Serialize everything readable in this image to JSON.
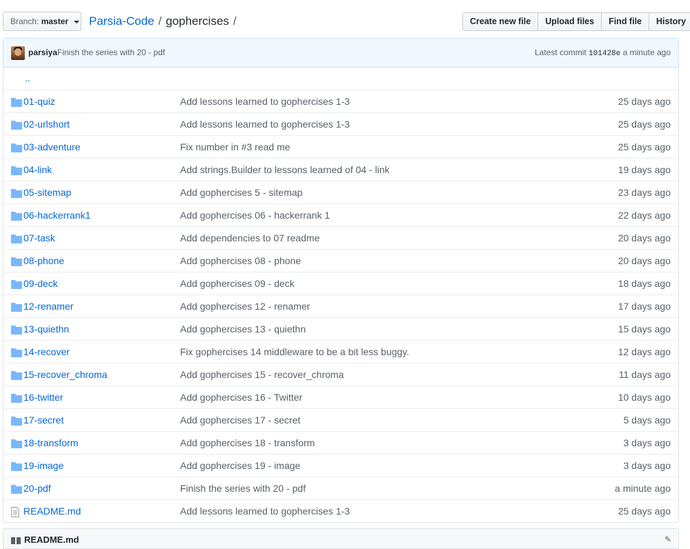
{
  "branch": {
    "label": "Branch:",
    "value": "master"
  },
  "breadcrumb": {
    "owner": "Parsia-Code",
    "separator": "/",
    "repo": "gophercises"
  },
  "actions": {
    "create_new_file": "Create new file",
    "upload_files": "Upload files",
    "find_file": "Find file",
    "history": "History"
  },
  "latest_commit": {
    "author": "parsiya",
    "message": "Finish the series with 20 - pdf",
    "label": "Latest commit",
    "sha": "101428e",
    "time": "a minute ago"
  },
  "parent_dir": "..",
  "files": [
    {
      "name": "01-quiz",
      "type": "dir",
      "message": "Add lessons learned to gophercises 1-3",
      "age": "25 days ago"
    },
    {
      "name": "02-urlshort",
      "type": "dir",
      "message": "Add lessons learned to gophercises 1-3",
      "age": "25 days ago"
    },
    {
      "name": "03-adventure",
      "type": "dir",
      "message": "Fix number in #3 read me",
      "age": "25 days ago"
    },
    {
      "name": "04-link",
      "type": "dir",
      "message": "Add strings.Builder to lessons learned of 04 - link",
      "age": "19 days ago"
    },
    {
      "name": "05-sitemap",
      "type": "dir",
      "message": "Add gophercises 5 - sitemap",
      "age": "23 days ago"
    },
    {
      "name": "06-hackerrank1",
      "type": "dir",
      "message": "Add gophercises 06 - hackerrank 1",
      "age": "22 days ago"
    },
    {
      "name": "07-task",
      "type": "dir",
      "message": "Add dependencies to 07 readme",
      "age": "20 days ago"
    },
    {
      "name": "08-phone",
      "type": "dir",
      "message": "Add gophercises 08 - phone",
      "age": "20 days ago"
    },
    {
      "name": "09-deck",
      "type": "dir",
      "message": "Add gophercises 09 - deck",
      "age": "18 days ago"
    },
    {
      "name": "12-renamer",
      "type": "dir",
      "message": "Add gophercises 12 - renamer",
      "age": "17 days ago"
    },
    {
      "name": "13-quiethn",
      "type": "dir",
      "message": "Add gophercises 13 - quiethn",
      "age": "15 days ago"
    },
    {
      "name": "14-recover",
      "type": "dir",
      "message": "Fix gophercises 14 middleware to be a bit less buggy.",
      "age": "12 days ago"
    },
    {
      "name": "15-recover_chroma",
      "type": "dir",
      "message": "Add gophercises 15 - recover_chroma",
      "age": "11 days ago"
    },
    {
      "name": "16-twitter",
      "type": "dir",
      "message": "Add gophercises 16 - Twitter",
      "age": "10 days ago"
    },
    {
      "name": "17-secret",
      "type": "dir",
      "message": "Add gophercises 17 - secret",
      "age": "5 days ago"
    },
    {
      "name": "18-transform",
      "type": "dir",
      "message": "Add gophercises 18 - transform",
      "age": "3 days ago"
    },
    {
      "name": "19-image",
      "type": "dir",
      "message": "Add gophercises 19 - image",
      "age": "3 days ago"
    },
    {
      "name": "20-pdf",
      "type": "dir",
      "message": "Finish the series with 20 - pdf",
      "age": "a minute ago"
    },
    {
      "name": "README.md",
      "type": "file",
      "message": "Add lessons learned to gophercises 1-3",
      "age": "25 days ago"
    }
  ],
  "readme": {
    "title": "README.md"
  },
  "icons": {
    "dir": "folder-icon",
    "file": "file-icon"
  },
  "colors": {
    "link": "#0366d6",
    "folder": "#79b8ff",
    "commit_bar": "#f1f8ff"
  }
}
